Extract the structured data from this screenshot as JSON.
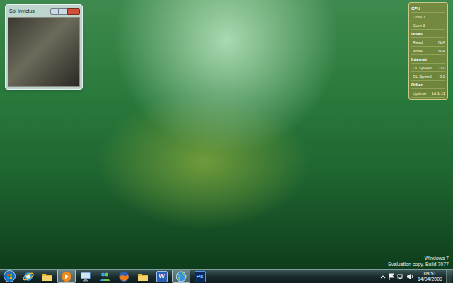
{
  "desktop": {
    "watermark": [
      "Windows 7",
      "Evaluation copy. Build 7077"
    ]
  },
  "media_window": {
    "title": "Sol Invictus"
  },
  "gadget": {
    "rows": [
      {
        "kind": "header",
        "label": "CPU",
        "value": ""
      },
      {
        "kind": "row",
        "label": "Core 1",
        "value": ""
      },
      {
        "kind": "row",
        "label": "Core 2",
        "value": ""
      },
      {
        "kind": "header",
        "label": "Disks",
        "value": ""
      },
      {
        "kind": "row",
        "label": "Read",
        "value": "N/A"
      },
      {
        "kind": "row",
        "label": "Write",
        "value": "N/A"
      },
      {
        "kind": "header",
        "label": "Internet",
        "value": ""
      },
      {
        "kind": "row",
        "label": "UL Speed",
        "value": "0.0"
      },
      {
        "kind": "row",
        "label": "DL Speed",
        "value": "0.0"
      },
      {
        "kind": "header",
        "label": "Other",
        "value": ""
      },
      {
        "kind": "row",
        "label": "Uptime",
        "value": "1d 1:11"
      }
    ]
  },
  "taskbar": {
    "items": [
      {
        "kind": "ie",
        "label": "",
        "active": false
      },
      {
        "kind": "folder",
        "label": "",
        "active": false
      },
      {
        "kind": "media",
        "label": "",
        "active": true
      },
      {
        "kind": "monitor",
        "label": "",
        "active": false
      },
      {
        "kind": "people",
        "label": "",
        "active": false
      },
      {
        "kind": "firefox",
        "label": "",
        "active": false
      },
      {
        "kind": "folder",
        "label": "",
        "active": false
      },
      {
        "kind": "word",
        "label": "W",
        "active": false
      },
      {
        "kind": "globe",
        "label": "",
        "active": true
      },
      {
        "kind": "photoshop",
        "label": "Ps",
        "active": false
      }
    ],
    "clock": {
      "time": "09:51",
      "date": "14/04/2009"
    }
  }
}
